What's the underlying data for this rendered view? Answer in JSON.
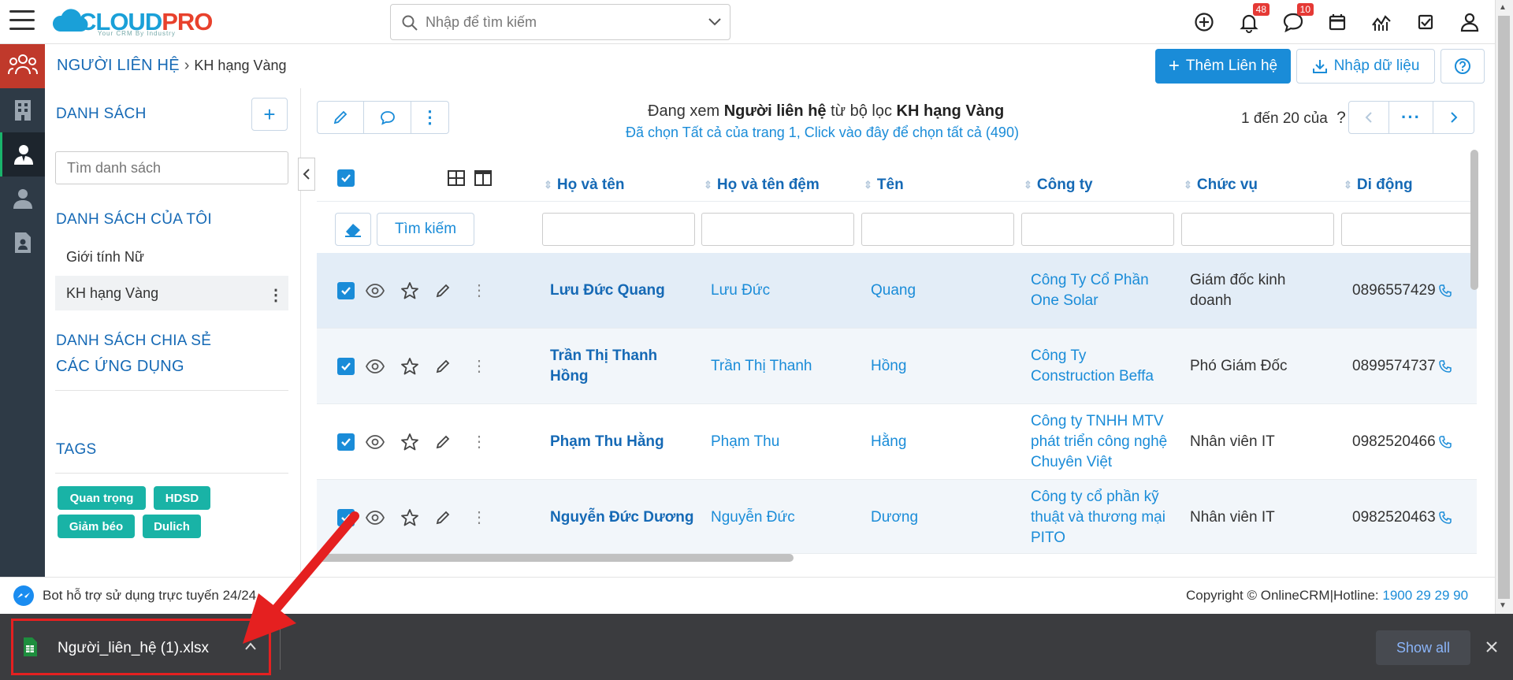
{
  "topbar": {
    "logo_main_a": "CLOUD",
    "logo_main_b": "PRO",
    "logo_tagline": "Your CRM By Industry",
    "search_placeholder": "Nhập để tìm kiếm",
    "notifications_count": "48",
    "messages_count": "10"
  },
  "breadcrumb": {
    "root": "NGƯỜI LIÊN HỆ",
    "current": "KH hạng Vàng"
  },
  "header_actions": {
    "add_label": "Thêm Liên hệ",
    "import_label": "Nhập dữ liệu"
  },
  "leftpanel": {
    "list_title": "DANH SÁCH",
    "search_placeholder": "Tìm danh sách",
    "my_lists_title": "DANH SÁCH CỦA TÔI",
    "my_lists": [
      "Giới tính Nữ",
      "KH hạng Vàng"
    ],
    "shared_title": "DANH SÁCH CHIA SẺ",
    "apps_title": "CÁC ỨNG DỤNG",
    "tags_title": "TAGS",
    "tags": [
      "Quan trọng",
      "HDSD",
      "Giảm béo",
      "Dulich"
    ]
  },
  "main": {
    "info_prefix": "Đang xem",
    "info_module": "Người liên hệ",
    "info_mid": "từ bộ lọc",
    "info_filter": "KH hạng Vàng",
    "info_selection": "Đã chọn Tất cả của trang 1, Click vào đây để chọn tất cả (490)",
    "pager_text": "1 đến 20 của",
    "pager_unknown": "?",
    "search_button": "Tìm kiếm"
  },
  "table": {
    "columns": [
      "Họ và tên",
      "Họ và tên đệm",
      "Tên",
      "Công ty",
      "Chức vụ",
      "Di động"
    ],
    "rows": [
      {
        "full_name": "Lưu Đức Quang",
        "name_line2": "",
        "middle": "Lưu Đức",
        "first": "Quang",
        "company_l1": "Công Ty Cổ Phần",
        "company_l2": "One Solar",
        "company_l3": "",
        "title_l1": "Giám đốc kinh",
        "title_l2": "doanh",
        "mobile": "0896557429"
      },
      {
        "full_name": "Trần Thị Thanh",
        "name_line2": "Hồng",
        "middle": "Trần Thị Thanh",
        "first": "Hồng",
        "company_l1": "Công Ty",
        "company_l2": "Construction Beffa",
        "company_l3": "",
        "title_l1": "Phó Giám Đốc",
        "title_l2": "",
        "mobile": "0899574737"
      },
      {
        "full_name": "Phạm Thu Hằng",
        "name_line2": "",
        "middle": "Phạm Thu",
        "first": "Hằng",
        "company_l1": "Công ty TNHH MTV",
        "company_l2": "phát triển công nghệ",
        "company_l3": "Chuyên Việt",
        "title_l1": "Nhân viên IT",
        "title_l2": "",
        "mobile": "0982520466"
      },
      {
        "full_name": "Nguyễn Đức Dương",
        "name_line2": "",
        "middle": "Nguyễn Đức",
        "first": "Dương",
        "company_l1": "Công ty cổ phần kỹ",
        "company_l2": "thuật và thương mại",
        "company_l3": "PITO",
        "title_l1": "Nhân viên IT",
        "title_l2": "",
        "mobile": "0982520463"
      }
    ]
  },
  "footer": {
    "bot_text": "Bot hỗ trợ sử dụng trực tuyến 24/24",
    "copyright": "Copyright © OnlineCRM|Hotline:",
    "hotline": "1900 29 29 90"
  },
  "downloadbar": {
    "filename": "Người_liên_hệ (1).xlsx",
    "show_all": "Show all"
  },
  "colors": {
    "primary": "#1a8cd8",
    "brand_dark": "#1569b5",
    "tag": "#19b3a6",
    "sidebar": "#2e3a46",
    "active_module": "#c0392b",
    "highlight": "#e52020"
  }
}
